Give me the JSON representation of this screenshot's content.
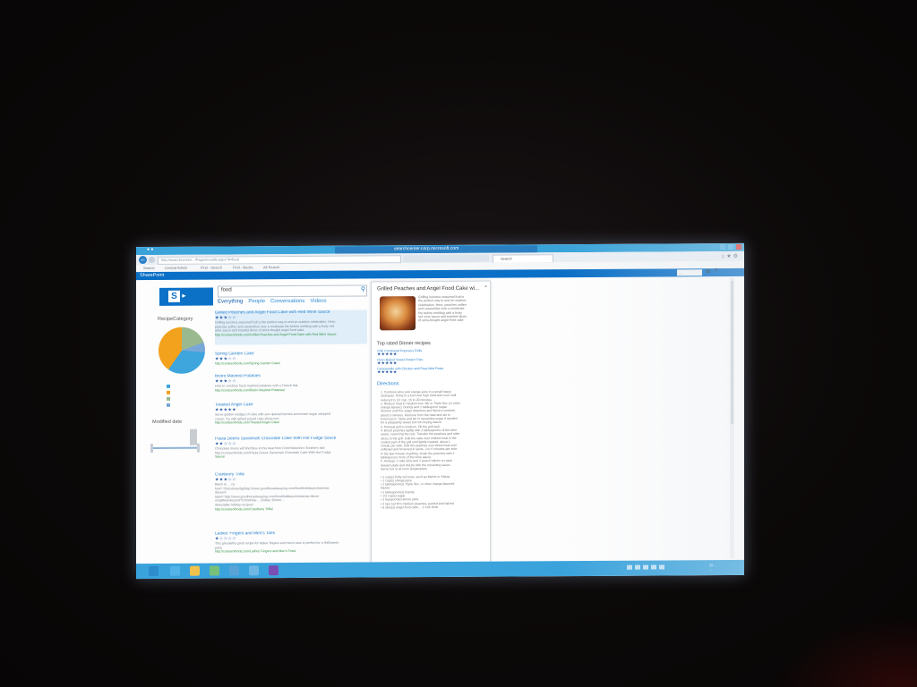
{
  "browser": {
    "tab_title": "searchcenter.corp.microsoft.com",
    "address": "http://searchcenter/.../Pages/results.aspx?k=food",
    "active_tab": "Search",
    "favorites": [
      "Search",
      "Central Admin",
      "Find - Search",
      "Find - Books",
      "All Search"
    ]
  },
  "suite": {
    "brand": "SharePoint",
    "user": "…",
    "gear_icon": "gear-icon",
    "help_icon": "help-icon"
  },
  "search": {
    "value": "food"
  },
  "verticals": [
    "Everything",
    "People",
    "Conversations",
    "Videos"
  ],
  "refiners": {
    "recipe_category": {
      "title": "RecipeCategory",
      "slices": []
    },
    "modified_date": {
      "title": "Modified date"
    }
  },
  "results": [
    {
      "title": "Grilled Peaches and Angel Food Cake with Red Wine Sauce",
      "stars": "★★★☆☆",
      "lines": [
        "Grilling luscious seasonal fruit is the perfect way to end an outdoor celebration. Here,",
        "peaches soften and caramelize over a moderate fire before melding with a fruity red",
        "wine sauce and toasted slices of store-bought angel food cake."
      ],
      "url": "http://contosofoods.com/Grilled Peaches and Angel Food Cake with Red Wine Sauce"
    },
    {
      "title": "Spring Garden Cake",
      "stars": "★★★☆☆",
      "lines": [],
      "url": "http://contosofoods.com/Spring Garden Cake/"
    },
    {
      "title": "Bistro Mashed Potatoes",
      "stars": "★★★☆☆",
      "lines": [
        "How to combine fresh mashed potatoes with a French flair"
      ],
      "url": "http://contosofoods.com/Bistro Mashed Potatoes/"
    },
    {
      "title": "Toasted Angel Cake",
      "stars": "★★★★★",
      "lines": [
        "Serve golden wedges of cake with sun-ripened berries and brown-sugar whipped",
        "cream. Try with grilled pound cake slices too!"
      ],
      "url": "http://contosofoods.com/Toasted Angel Cake/"
    },
    {
      "title": "Paula Deens Savannah Chocolate Cake With Hot Fudge Sauce",
      "stars": "★★☆☆☆",
      "lines": [
        "Chocolate lovers will find bliss in this beat from Food Network's Southern star",
        "http://contosofoods.com/Paula Deens Savannah Chocolate Cake With Hot Fudge"
      ],
      "url": "Sauce/"
    },
    {
      "title": "Cranberry Trifle",
      "stars": "★★★☆☆",
      "lines": [
        "Batch to ... ca",
        "href=\"/Christmas/Sg/http://www.goodhousekeeping.com/food/holidays/christmas",
        "dessert-",
        "label=\"http://www.goodhousekeeping.com/food/holidays/christmas-dinner",
        "simplified-dessert\"/Christmas ... &nbsp; Dinner ...",
        "delectable-holiday-recipes/"
      ],
      "url": "http://contosofoods.com/Cranberry Trifle/"
    },
    {
      "title": "Ladies' Fingers and Men's Toes",
      "stars": "★☆☆☆☆",
      "lines": [
        "This ghoulishly good recipe for ladies' fingers and men's toes is perfect for a Halloween",
        "party"
      ],
      "url": "http://contosofoods.com/Ladies' Fingers and Men's Toes/"
    }
  ],
  "hover_panel": {
    "title": "Grilled Peaches and Angel Food Cake wi...",
    "close": "×",
    "description": [
      "Grilling luscious seasonal fruit is",
      "the perfect way to end an outdoor",
      "celebration. Here, peaches soften",
      "and caramelize over a moderate",
      "fire before melding with a fruity",
      "red wine sauce and toasted slices",
      "of store-bought angel food cake."
    ],
    "top_rated_heading": "Top rated Dinner recipes",
    "top_rated": [
      {
        "title": "Chili Cornbread Popovers Rolls",
        "stars": "★★★★★"
      },
      {
        "title": "Oven-Baked Sweet Potato Fries",
        "stars": "★★★★★"
      },
      {
        "title": "Campanelle with Chicken and Pear-Mint Pesto",
        "stars": "★★★★★"
      }
    ],
    "directions_heading": "Directions",
    "directions": [
      "1. Combine wine and orange juice in a small heavy",
      "saucepan. Bring to a boil over high heat and cook until",
      "reduced to 1/2 cup, 15 to 20 minutes.",
      "2. Reduce heat to medium-low. Stir in Triple Sec (or other",
      "orange liqueur), brandy and 1 tablespoon sugar.",
      "Simmer until the sugar dissolves and flavors combine,",
      "about 3 minutes. Remove from the heat and stir in",
      "lemon juice. Taste and stir in remaining sugar if needed",
      "for a pleasantly sweet but not cloying sauce.",
      "3. Preheat grill to medium. Oil the grill rack.",
      "4. Brush peaches lightly with 2 tablespoons of the wine",
      "sauce, reserving the rest. Transfer the peaches and cake",
      "slices to the grill. Grill the cake over indirect heat in the",
      "coolest part of the grill until lightly toasted, about 1",
      "minute per side. Grill the peaches over direct heat until",
      "softened and browned in spots, 3 to 5 minutes per side.",
      "In the last minute of grilling, brush the peaches with 2",
      "tablespoons more of the wine sauce.",
      "5. Arrange 1 cake slice and 2 peach halves on each",
      "dessert plate and drizzle with the remaining sauce.",
      "Serve hot or at room temperature.",
      "",
      "• 2 cup(s) fruity red wine, such as Merlot or Shiraz",
      "• 1 cup(s) orange juice",
      "• 2 tablespoon(s) Triple Sec, or other orange-flavored",
      "liqueur",
      "• 2 tablespoon(s) brandy",
      "• 1/3 cup(s) sugar",
      "• 2 teaspoon(s) lemon juice",
      "• 4 ripe but firm medium peaches, peeled and halved",
      "• 8 slice(s) angel food cake, ...1 inch thick"
    ]
  },
  "taskbar": {
    "apps": [
      "windows-start-icon",
      "ie-icon",
      "explorer-icon",
      "tool-icon",
      "network-icon",
      "mail-icon",
      "visual-studio-icon"
    ],
    "clock": [
      "11:...",
      "..."
    ]
  },
  "colors": {
    "accent": "#0a6fc6",
    "taskbar": "#3aa3dc",
    "titlebar": "#39a3d9",
    "link": "#2a83cf"
  }
}
